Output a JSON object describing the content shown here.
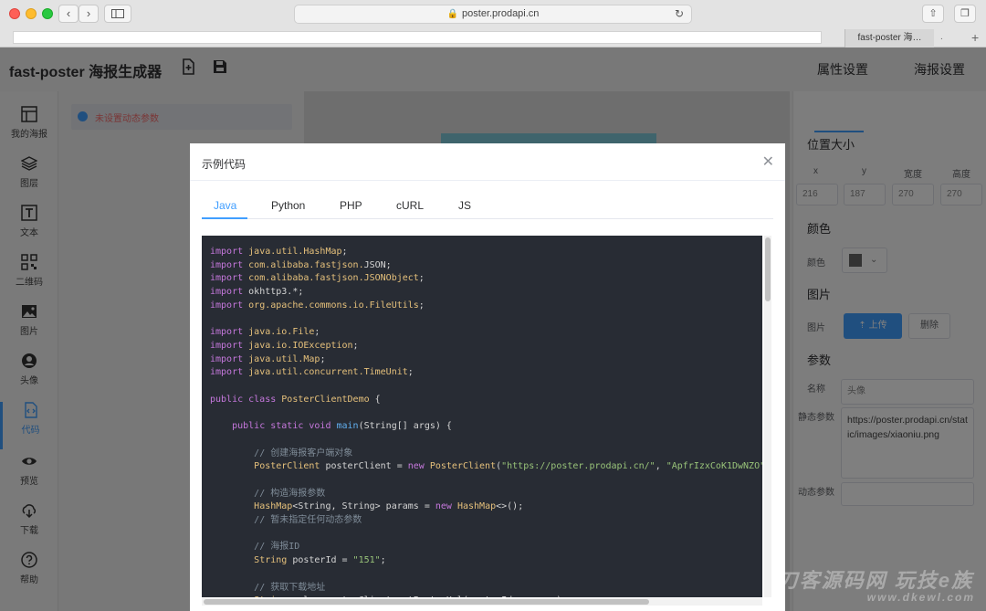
{
  "browser": {
    "url": "poster.prodapi.cn",
    "tab_title": "fast-poster 海…",
    "tab_extra": "."
  },
  "app": {
    "title": "fast-poster 海报生成器"
  },
  "sidebar": {
    "items": [
      {
        "label": "我的海报",
        "icon": "layout-icon"
      },
      {
        "label": "图层",
        "icon": "layers-icon"
      },
      {
        "label": "文本",
        "icon": "text-icon"
      },
      {
        "label": "二维码",
        "icon": "qrcode-icon"
      },
      {
        "label": "图片",
        "icon": "image-icon"
      },
      {
        "label": "头像",
        "icon": "avatar-icon"
      },
      {
        "label": "代码",
        "icon": "code-icon"
      },
      {
        "label": "预览",
        "icon": "eye-icon"
      },
      {
        "label": "下载",
        "icon": "download-icon"
      },
      {
        "label": "帮助",
        "icon": "help-icon"
      }
    ],
    "active": "代码"
  },
  "layers": {
    "item_label": "未设置动态参数"
  },
  "props": {
    "tabs": [
      "属性设置",
      "海报设置"
    ],
    "position_title": "位置大小",
    "fields": [
      {
        "label": "x",
        "value": "216"
      },
      {
        "label": "y",
        "value": "187"
      },
      {
        "label": "宽度",
        "value": "270"
      },
      {
        "label": "高度",
        "value": "270"
      }
    ],
    "color_title": "颜色",
    "color_label": "颜色",
    "image_title": "图片",
    "image_label": "图片",
    "upload_label": "上传",
    "delete_label": "删除",
    "param_title": "参数",
    "name_label": "名称",
    "name_placeholder": "头像",
    "static_label": "静态参数",
    "static_value": "https://poster.prodapi.cn/static/images/xiaoniu.png",
    "dynamic_label": "动态参数",
    "selected_color": "#666666"
  },
  "dialog": {
    "title": "示例代码",
    "tabs": [
      "Java",
      "Python",
      "PHP",
      "cURL",
      "JS"
    ],
    "active_tab": "Java",
    "code_lines": [
      [
        [
          "kw",
          "import "
        ],
        [
          "cls",
          "java.util.HashMap"
        ],
        [
          "",
          "; "
        ]
      ],
      [
        [
          "kw",
          "import "
        ],
        [
          "cls",
          "com.alibaba.fastjson."
        ],
        [
          "",
          "JSON;"
        ]
      ],
      [
        [
          "kw",
          "import "
        ],
        [
          "cls",
          "com.alibaba.fastjson.JSONObject"
        ],
        [
          "",
          ";"
        ]
      ],
      [
        [
          "kw",
          "import "
        ],
        [
          "",
          "okhttp3.*;"
        ]
      ],
      [
        [
          "kw",
          "import "
        ],
        [
          "cls",
          "org.apache.commons.io.FileUtils"
        ],
        [
          "",
          ";"
        ]
      ],
      [],
      [
        [
          "kw",
          "import "
        ],
        [
          "cls",
          "java.io.File"
        ],
        [
          "",
          ";"
        ]
      ],
      [
        [
          "kw",
          "import "
        ],
        [
          "cls",
          "java.io.IOException"
        ],
        [
          "",
          ";"
        ]
      ],
      [
        [
          "kw",
          "import "
        ],
        [
          "cls",
          "java.util.Map"
        ],
        [
          "",
          ";"
        ]
      ],
      [
        [
          "kw",
          "import "
        ],
        [
          "cls",
          "java.util.concurrent.TimeUnit"
        ],
        [
          "",
          ";"
        ]
      ],
      [],
      [
        [
          "kw",
          "public class "
        ],
        [
          "cls",
          "PosterClientDemo"
        ],
        [
          "",
          " {"
        ]
      ],
      [],
      [
        [
          "",
          "    "
        ],
        [
          "kw",
          "public static void "
        ],
        [
          "fn",
          "main"
        ],
        [
          "",
          "(String[] args) {"
        ]
      ],
      [],
      [
        [
          "",
          "        "
        ],
        [
          "com",
          "// 创建海报客户端对象"
        ]
      ],
      [
        [
          "",
          "        "
        ],
        [
          "cls",
          "PosterClient"
        ],
        [
          "",
          " posterClient = "
        ],
        [
          "kw",
          "new "
        ],
        [
          "cls",
          "PosterClient"
        ],
        [
          "",
          "("
        ],
        [
          "str",
          "\"https://poster.prodapi.cn/\""
        ],
        [
          "",
          ", "
        ],
        [
          "str",
          "\"ApfrIzxCoK1DwNZO\""
        ],
        [
          "",
          ","
        ]
      ],
      [],
      [
        [
          "",
          "        "
        ],
        [
          "com",
          "// 构造海报参数"
        ]
      ],
      [
        [
          "",
          "        "
        ],
        [
          "cls",
          "HashMap"
        ],
        [
          "",
          "<String, String> params = "
        ],
        [
          "kw",
          "new "
        ],
        [
          "cls",
          "HashMap"
        ],
        [
          "",
          "<>();"
        ]
      ],
      [
        [
          "",
          "        "
        ],
        [
          "com",
          "// 暂未指定任何动态参数"
        ]
      ],
      [],
      [
        [
          "",
          "        "
        ],
        [
          "com",
          "// 海报ID"
        ]
      ],
      [
        [
          "",
          "        "
        ],
        [
          "cls",
          "String"
        ],
        [
          "",
          " posterId = "
        ],
        [
          "str",
          "\"151\""
        ],
        [
          "",
          ";"
        ]
      ],
      [],
      [
        [
          "",
          "        "
        ],
        [
          "com",
          "// 获取下载地址"
        ]
      ],
      [
        [
          "",
          "        "
        ],
        [
          "cls",
          "String"
        ],
        [
          "",
          " url = posterClient.getPosterUrl(posterId, params);"
        ]
      ]
    ]
  },
  "watermark": {
    "line1": "刀客源码网 玩技e族",
    "line2": "www.dkewl.com"
  }
}
